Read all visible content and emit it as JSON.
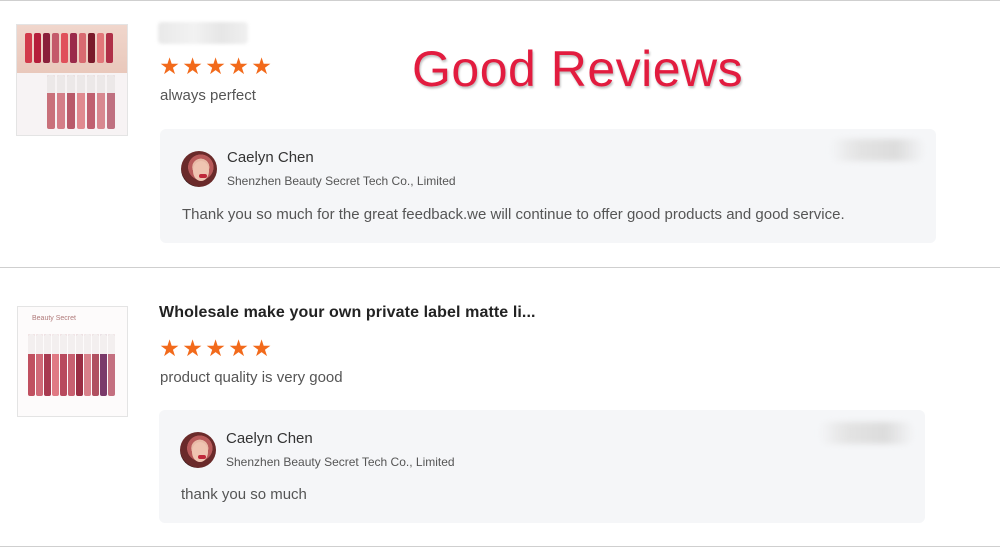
{
  "banner": {
    "text": "Good Reviews",
    "color": "#e21c3f"
  },
  "star_color": "#f26a1b",
  "reviews": [
    {
      "product_image": "lip-swatch-photo",
      "rating": 5,
      "comment": "always perfect",
      "reply": {
        "seller_name": "Caelyn Chen",
        "company": "Shenzhen Beauty Secret Tech Co., Limited",
        "text": "Thank you so much for the great feedback.we will continue to offer good products and good service."
      }
    },
    {
      "product_image": "lipgloss-box-photo",
      "product_title": "Wholesale make your own private label matte li...",
      "rating": 5,
      "comment": "product quality is very good",
      "reply": {
        "seller_name": "Caelyn Chen",
        "company": "Shenzhen Beauty Secret Tech Co., Limited",
        "text": "thank you so much"
      }
    }
  ]
}
